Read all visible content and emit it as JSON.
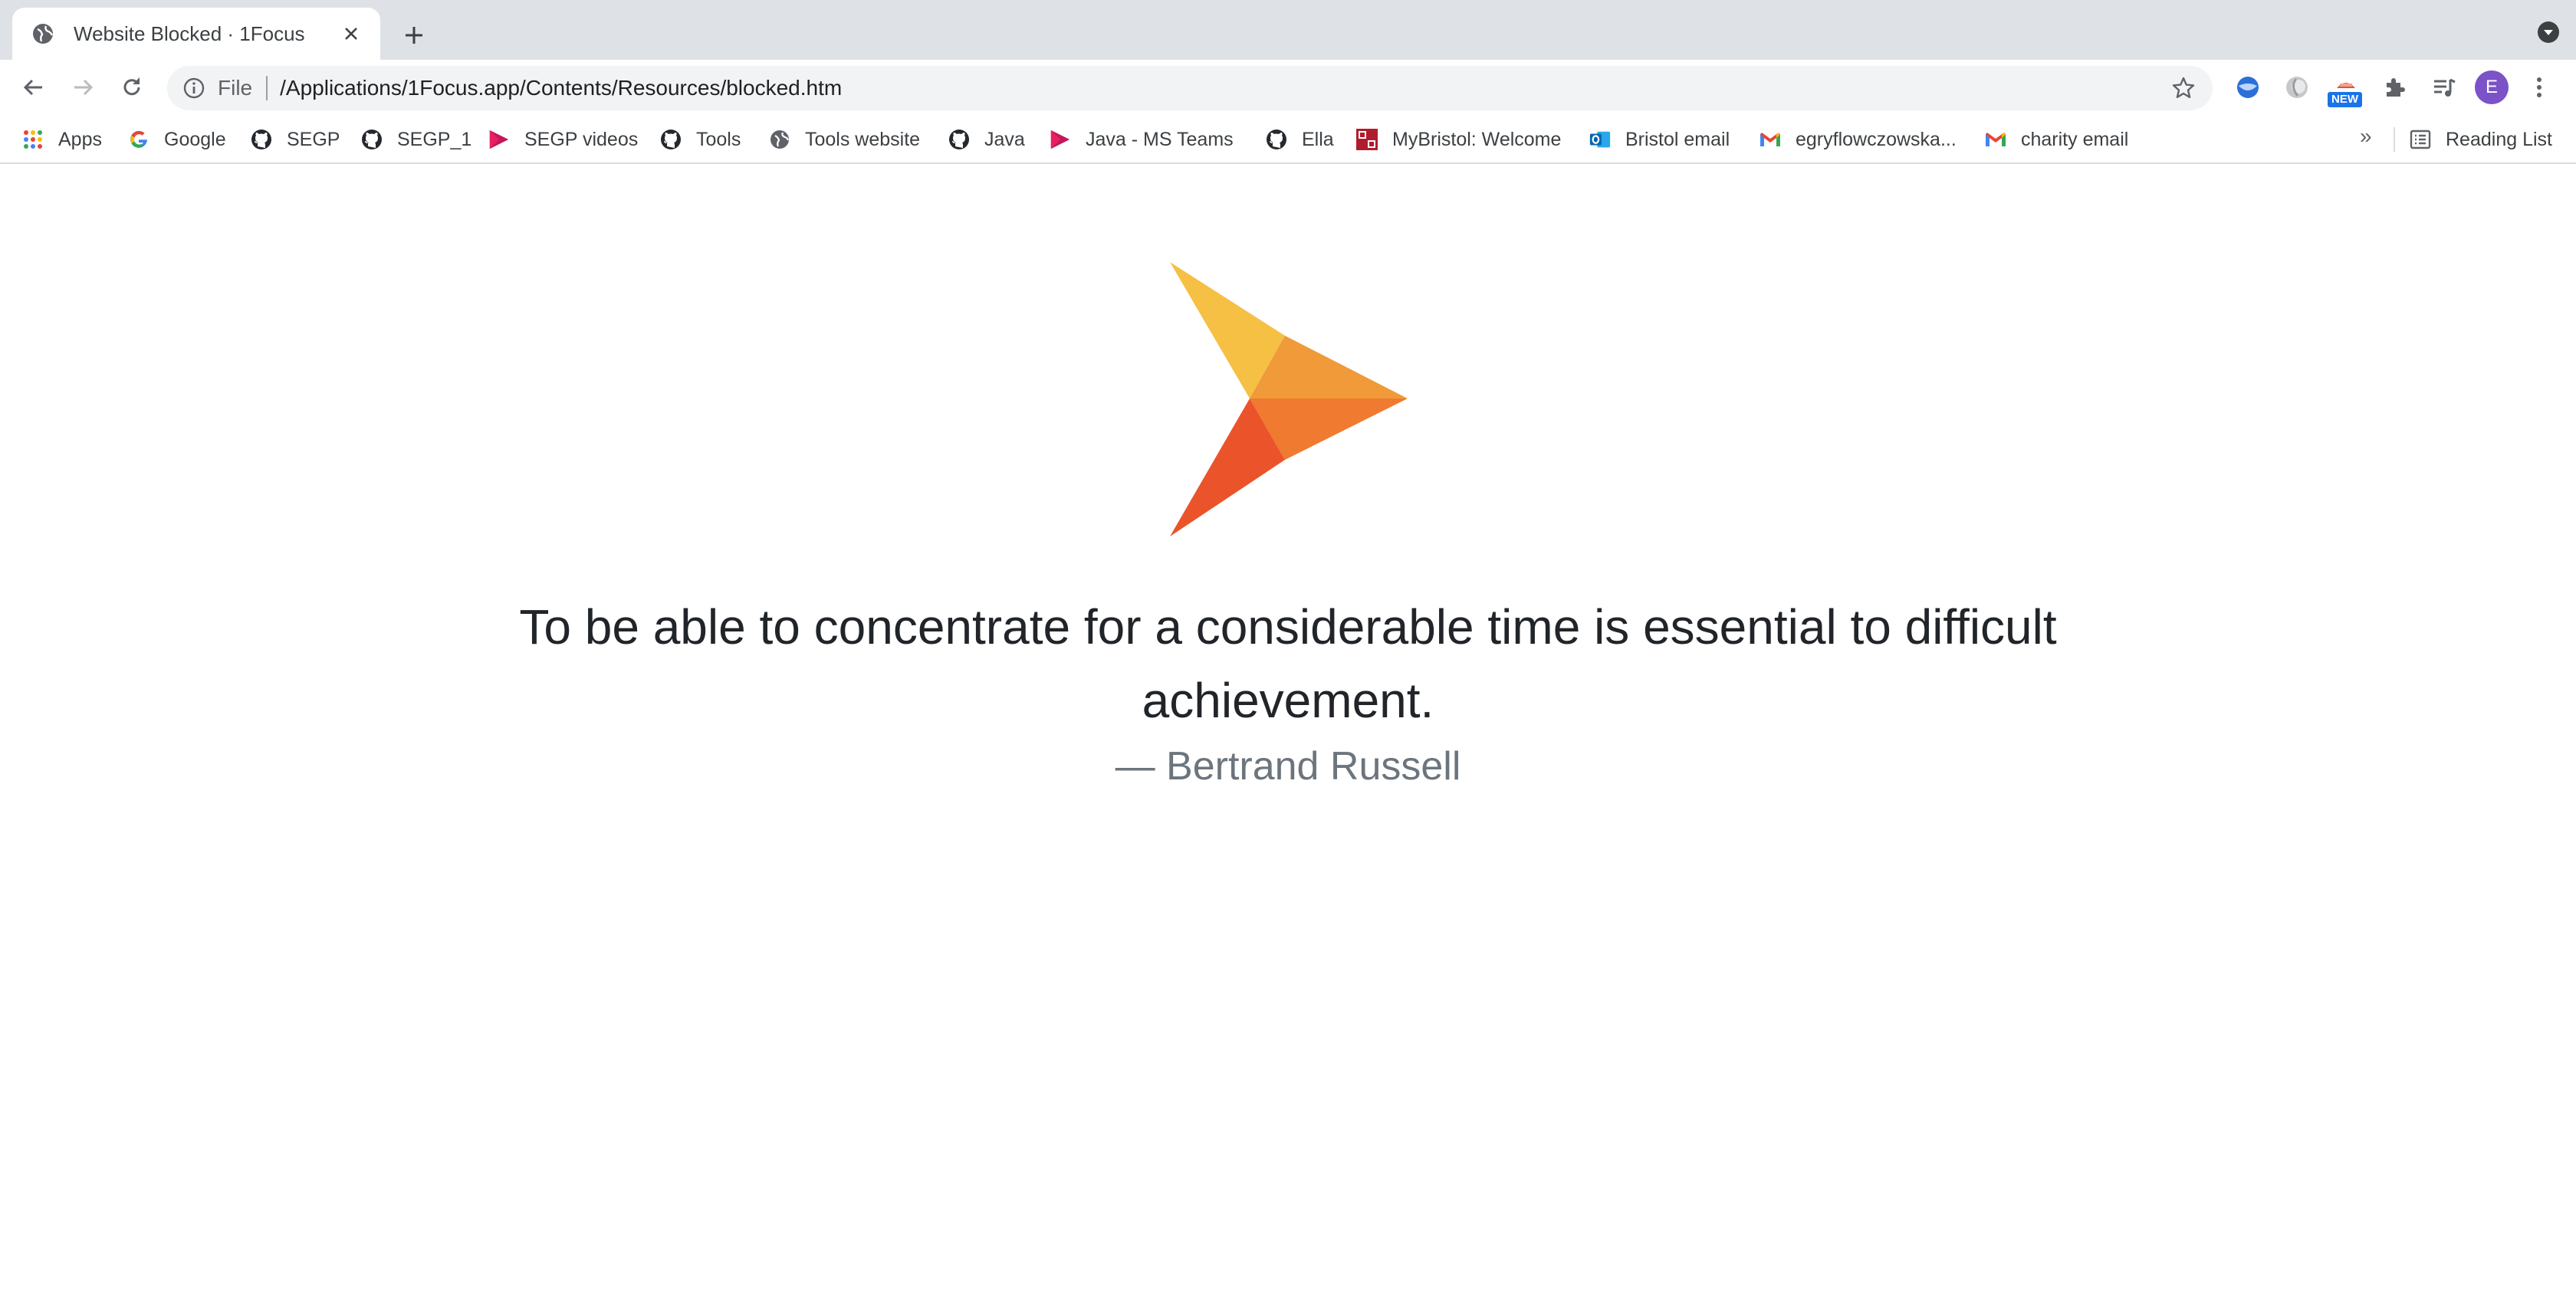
{
  "tab": {
    "title": "Website Blocked · 1Focus",
    "favicon": "globe-icon"
  },
  "toolbar": {
    "scheme_label": "File",
    "url": "/Applications/1Focus.app/Contents/Resources/blocked.htm",
    "new_badge": "NEW",
    "avatar_letter": "E"
  },
  "bookmarks": [
    {
      "label": "Apps",
      "icon": "apps-grid-icon"
    },
    {
      "label": "Google",
      "icon": "google-icon"
    },
    {
      "label": "SEGP",
      "icon": "github-icon"
    },
    {
      "label": "SEGP_1",
      "icon": "github-icon"
    },
    {
      "label": "SEGP videos",
      "icon": "play-icon"
    },
    {
      "label": "Tools",
      "icon": "github-icon"
    },
    {
      "label": "Tools website",
      "icon": "globe-icon"
    },
    {
      "label": "Java",
      "icon": "github-icon"
    },
    {
      "label": "Java - MS Teams",
      "icon": "play-icon"
    },
    {
      "label": "Ella",
      "icon": "github-icon"
    },
    {
      "label": "MyBristol: Welcome",
      "icon": "bristol-icon"
    },
    {
      "label": "Bristol email",
      "icon": "outlook-icon"
    },
    {
      "label": "egryflowczowska...",
      "icon": "gmail-icon"
    },
    {
      "label": "charity email",
      "icon": "gmail-icon"
    }
  ],
  "bookmarks_overflow": "»",
  "reading_list": "Reading List",
  "content": {
    "quote": "To be able to concentrate for a considerable time is essential to difficult achievement.",
    "author": "— Bertrand Russell"
  },
  "colors": {
    "logo_yellow": "#f5c044",
    "logo_orange": "#f09a3a",
    "logo_dark_orange": "#ef7a30",
    "logo_red": "#eb542a",
    "quote_text": "#212529",
    "author_text": "#6c757d"
  }
}
